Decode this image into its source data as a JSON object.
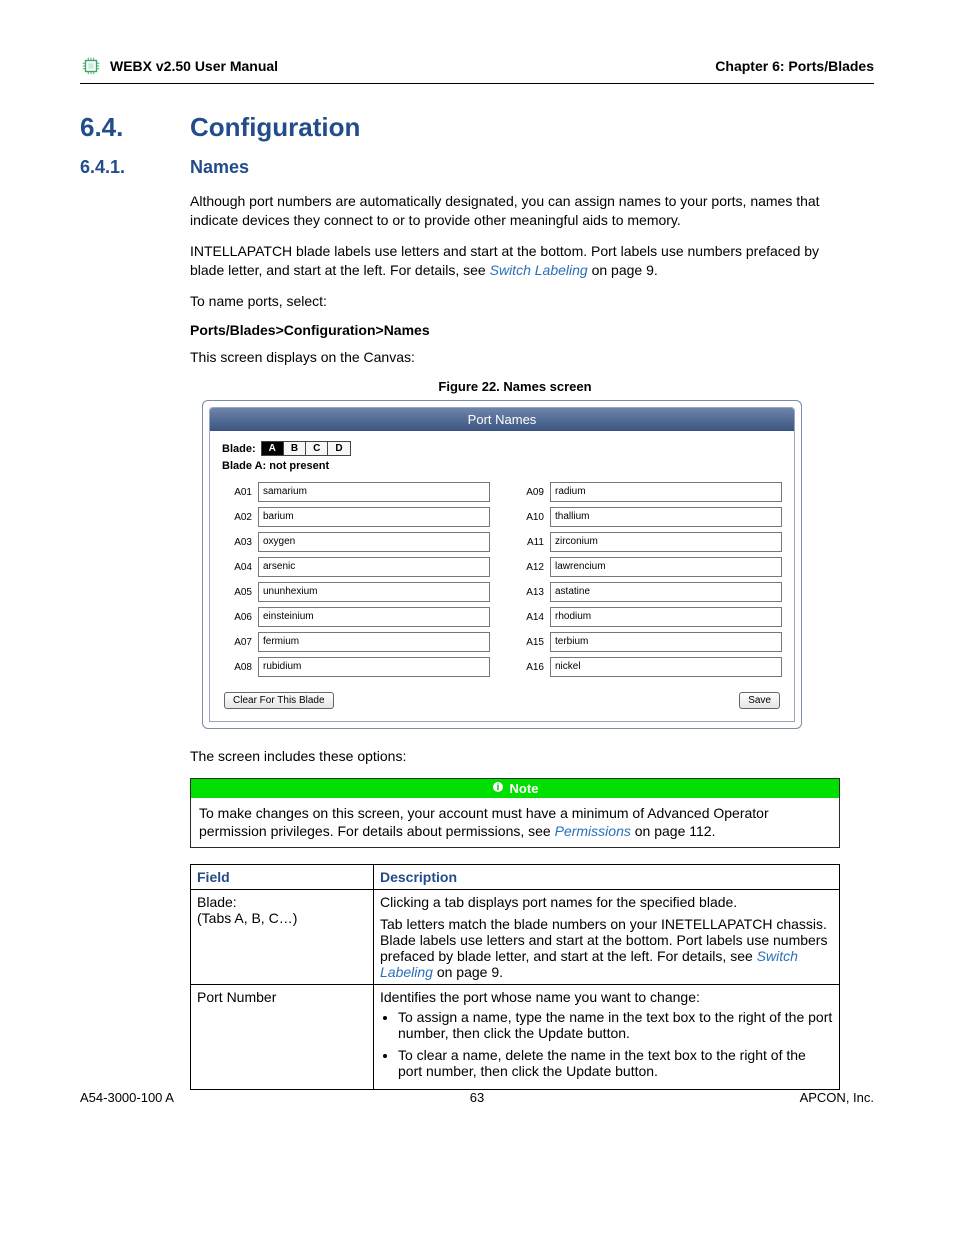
{
  "header": {
    "left": "WEBX v2.50 User Manual",
    "right": "Chapter 6: Ports/Blades"
  },
  "section": {
    "num": "6.4.",
    "title": "Configuration"
  },
  "subsection": {
    "num": "6.4.1.",
    "title": "Names"
  },
  "paragraphs": {
    "p1": "Although port numbers are automatically designated, you can assign names to your ports, names that indicate devices they connect to or to provide other meaningful aids to memory.",
    "p2a": "INTELLAPATCH",
    "p2b": " blade labels use letters and start at the bottom. Port labels use numbers prefaced by blade letter, and start at the left. For details, see ",
    "p2link": "Switch Labeling",
    "p2c": " on page 9.",
    "p3": "To name ports, select:",
    "menu": "Ports/Blades>Configuration>Names",
    "p4": "This screen displays on the Canvas:",
    "figcap": "Figure 22. Names screen",
    "p5": "The screen includes these options:"
  },
  "panel": {
    "title": "Port Names",
    "blade_label": "Blade:",
    "tabs": [
      "A",
      "B",
      "C",
      "D"
    ],
    "status": "Blade A: not present",
    "left_ports": [
      {
        "id": "A01",
        "name": "samarium"
      },
      {
        "id": "A02",
        "name": "barium"
      },
      {
        "id": "A03",
        "name": "oxygen"
      },
      {
        "id": "A04",
        "name": "arsenic"
      },
      {
        "id": "A05",
        "name": "ununhexium"
      },
      {
        "id": "A06",
        "name": "einsteinium"
      },
      {
        "id": "A07",
        "name": "fermium"
      },
      {
        "id": "A08",
        "name": "rubidium"
      }
    ],
    "right_ports": [
      {
        "id": "A09",
        "name": "radium"
      },
      {
        "id": "A10",
        "name": "thallium"
      },
      {
        "id": "A11",
        "name": "zirconium"
      },
      {
        "id": "A12",
        "name": "lawrencium"
      },
      {
        "id": "A13",
        "name": "astatine"
      },
      {
        "id": "A14",
        "name": "rhodium"
      },
      {
        "id": "A15",
        "name": "terbium"
      },
      {
        "id": "A16",
        "name": "nickel"
      }
    ],
    "clear_btn": "Clear For This Blade",
    "save_btn": "Save"
  },
  "note": {
    "title": "Note",
    "body_a": "To make changes on this screen, your account must have a minimum of Advanced Operator permission privileges. For details about permissions, see ",
    "link": "Permissions",
    "body_b": " on page 112."
  },
  "table": {
    "h1": "Field",
    "h2": "Description",
    "r1c1a": "Blade:",
    "r1c1b": "(Tabs A, B, C…)",
    "r1c2a": "Clicking a tab displays port names for the specified blade.",
    "r1c2b_a": "Tab letters match the blade numbers on your ",
    "r1c2b_sc": "INETELLAPATCH",
    "r1c2b_b": " chassis. Blade labels use letters and start at the bottom. Port labels use numbers prefaced by blade letter, and start at the left. For details, see ",
    "r1c2b_link": "Switch Labeling",
    "r1c2b_c": " on page 9.",
    "r2c1": "Port Number",
    "r2c2a": "Identifies the port whose name you want to change:",
    "r2c2b1": "To assign a name, type the name in the text box to the right of the port number, then click the Update button.",
    "r2c2b2": "To clear a name, delete the name in the text box to the right of the port number, then click the Update button."
  },
  "footer": {
    "left": "A54-3000-100 A",
    "center": "63",
    "right_a": "APCON",
    "right_b": ", Inc."
  }
}
